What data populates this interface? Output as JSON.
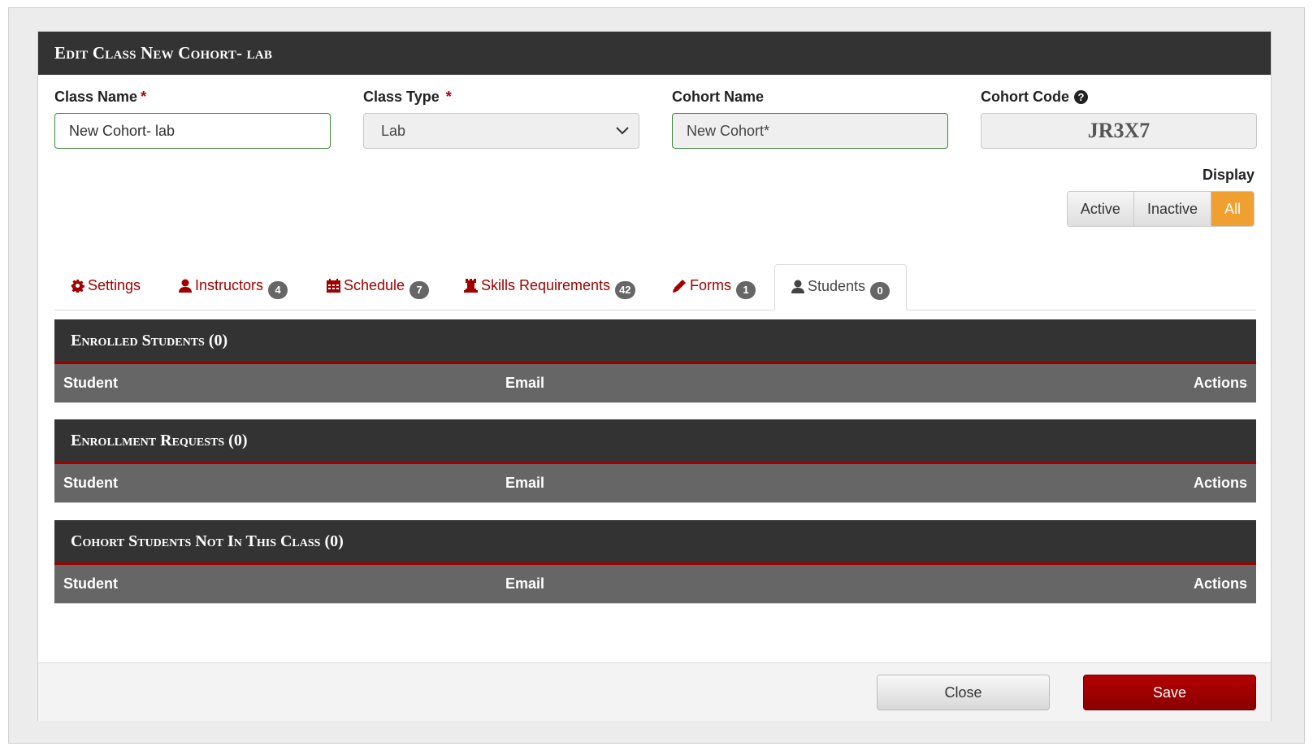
{
  "modal": {
    "title": "Edit Class New Cohort- lab"
  },
  "form": {
    "class_name_label": "Class Name",
    "class_name_value": "New Cohort- lab",
    "class_type_label": "Class Type",
    "class_type_value": "Lab",
    "cohort_name_label": "Cohort Name",
    "cohort_name_value": "New Cohort*",
    "cohort_code_label": "Cohort Code",
    "cohort_code_value": "JR3X7",
    "required_mark": "*"
  },
  "display": {
    "label": "Display",
    "options": [
      "Active",
      "Inactive",
      "All"
    ],
    "selected": "All"
  },
  "tabs": [
    {
      "label": "Settings",
      "icon": "gear-icon",
      "count": null
    },
    {
      "label": "Instructors",
      "icon": "user-icon",
      "count": "4"
    },
    {
      "label": "Schedule",
      "icon": "calendar-icon",
      "count": "7"
    },
    {
      "label": "Skills Requirements",
      "icon": "chess-rook-icon",
      "count": "42"
    },
    {
      "label": "Forms",
      "icon": "pencil-icon",
      "count": "1"
    },
    {
      "label": "Students",
      "icon": "user-icon",
      "count": "0",
      "active": true
    }
  ],
  "sections": [
    {
      "title": "Enrolled Students (0)",
      "columns": [
        "Student",
        "Email",
        "Actions"
      ]
    },
    {
      "title": "Enrollment Requests (0)",
      "columns": [
        "Student",
        "Email",
        "Actions"
      ]
    },
    {
      "title": "Cohort Students Not In This Class (0)",
      "columns": [
        "Student",
        "Email",
        "Actions"
      ]
    }
  ],
  "footer": {
    "close_label": "Close",
    "save_label": "Save"
  },
  "colors": {
    "accent": "#a00000",
    "header_bg": "#333333",
    "table_head_bg": "#666666",
    "active_toggle": "#f0a030"
  }
}
